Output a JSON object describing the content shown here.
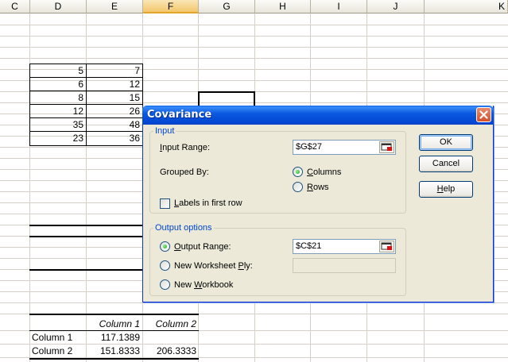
{
  "sheet": {
    "columns": [
      "C",
      "D",
      "E",
      "F",
      "G",
      "H",
      "I",
      "J",
      "K"
    ],
    "selected_column": "F",
    "data_rows": [
      {
        "c": "5",
        "d": "7"
      },
      {
        "c": "6",
        "d": "12"
      },
      {
        "c": "8",
        "d": "15"
      },
      {
        "c": "12",
        "d": "26"
      },
      {
        "c": "35",
        "d": "48"
      },
      {
        "c": "23",
        "d": "36"
      }
    ],
    "cov_header": {
      "d": "Column 1",
      "e": "Column 2"
    },
    "cov_rows": [
      {
        "label": "Column 1",
        "col1": "117.1389",
        "col2": ""
      },
      {
        "label": "Column 2",
        "col1": "151.8333",
        "col2": "206.3333"
      }
    ]
  },
  "dialog": {
    "title": "Covariance",
    "input_group": "Input",
    "input_range_label": "Input Range:",
    "input_range_value": "$G$27",
    "grouped_by_label": "Grouped By:",
    "columns_label": "Columns",
    "rows_label": "Rows",
    "grouped_by_selected": "Columns",
    "labels_first_row": "Labels in first row",
    "labels_checked": false,
    "output_group": "Output options",
    "output_range_label": "Output Range:",
    "output_range_value": "$C$21",
    "new_ply_label": "New Worksheet Ply:",
    "new_ply_value": "",
    "new_workbook_label": "New Workbook",
    "output_selected": "Output Range",
    "ok": "OK",
    "cancel": "Cancel",
    "help": "Help"
  }
}
